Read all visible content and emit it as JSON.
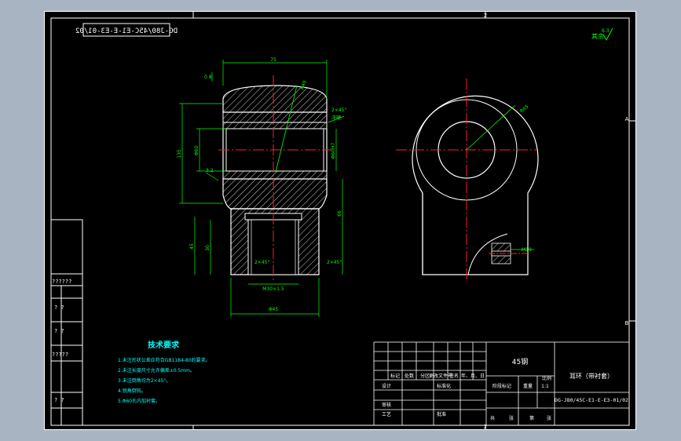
{
  "drawing": {
    "header_code": "DG-J80/45C-E1-E-E3-01/02",
    "roughness": "其余",
    "roughness_value": "6.3",
    "zone_numbers": [
      "2",
      "3"
    ],
    "zone_letters": [
      "A",
      "B"
    ],
    "left_column_labels": [
      "??????",
      "? ?",
      "? ?",
      "?????",
      "? ?"
    ]
  },
  "dimensions": {
    "width_top": "75",
    "radius_top": "R40",
    "chamfer_top": "2×45°",
    "note_surface": "淬硬",
    "height_total": "135",
    "inner_dia": "Φ60",
    "bore_tol": "Φ60H7",
    "gap": "3.2",
    "offset": "0.8",
    "flange_h": "45",
    "depth": "30",
    "side_dim": "66",
    "chamfer_bottom_left": "2×45°",
    "chamfer_bottom_right": "2×45°",
    "thread": "M30×1.5",
    "bottom_width": "Φ45",
    "big_radius": "R65",
    "thread_side": "M10"
  },
  "tech_req": {
    "title": "技术要求",
    "items": [
      "1.未注形状公差应符合GB1184-80的要求。",
      "2.未注长度尺寸允许偏差±0.5mm。",
      "3.未注倒角均为2×45°。",
      "4.锐角倒钝。",
      "5.Φ60孔内加衬套。"
    ]
  },
  "title_block": {
    "material": "45钢",
    "part_name": "耳环（带衬套）",
    "drawing_no": "DG-J80/45C-E1-E-E3-01/02",
    "scale": "1:1",
    "headers": [
      "标记",
      "处数",
      "分区",
      "更改文件号",
      "签名",
      "年、月、日"
    ],
    "roles": [
      "设计",
      "标准化",
      "审核",
      "工艺",
      "批准"
    ],
    "stage_labels": [
      "阶段标记",
      "重量",
      "比例"
    ],
    "sheet_labels": [
      "共",
      "张",
      "第",
      "张"
    ]
  },
  "colors": {
    "background": "#000000",
    "outline": "#ffffff",
    "dimension": "#00ff00",
    "centerline": "#ff2020",
    "border": "#ffffff",
    "tech_text": "#00ffff"
  }
}
